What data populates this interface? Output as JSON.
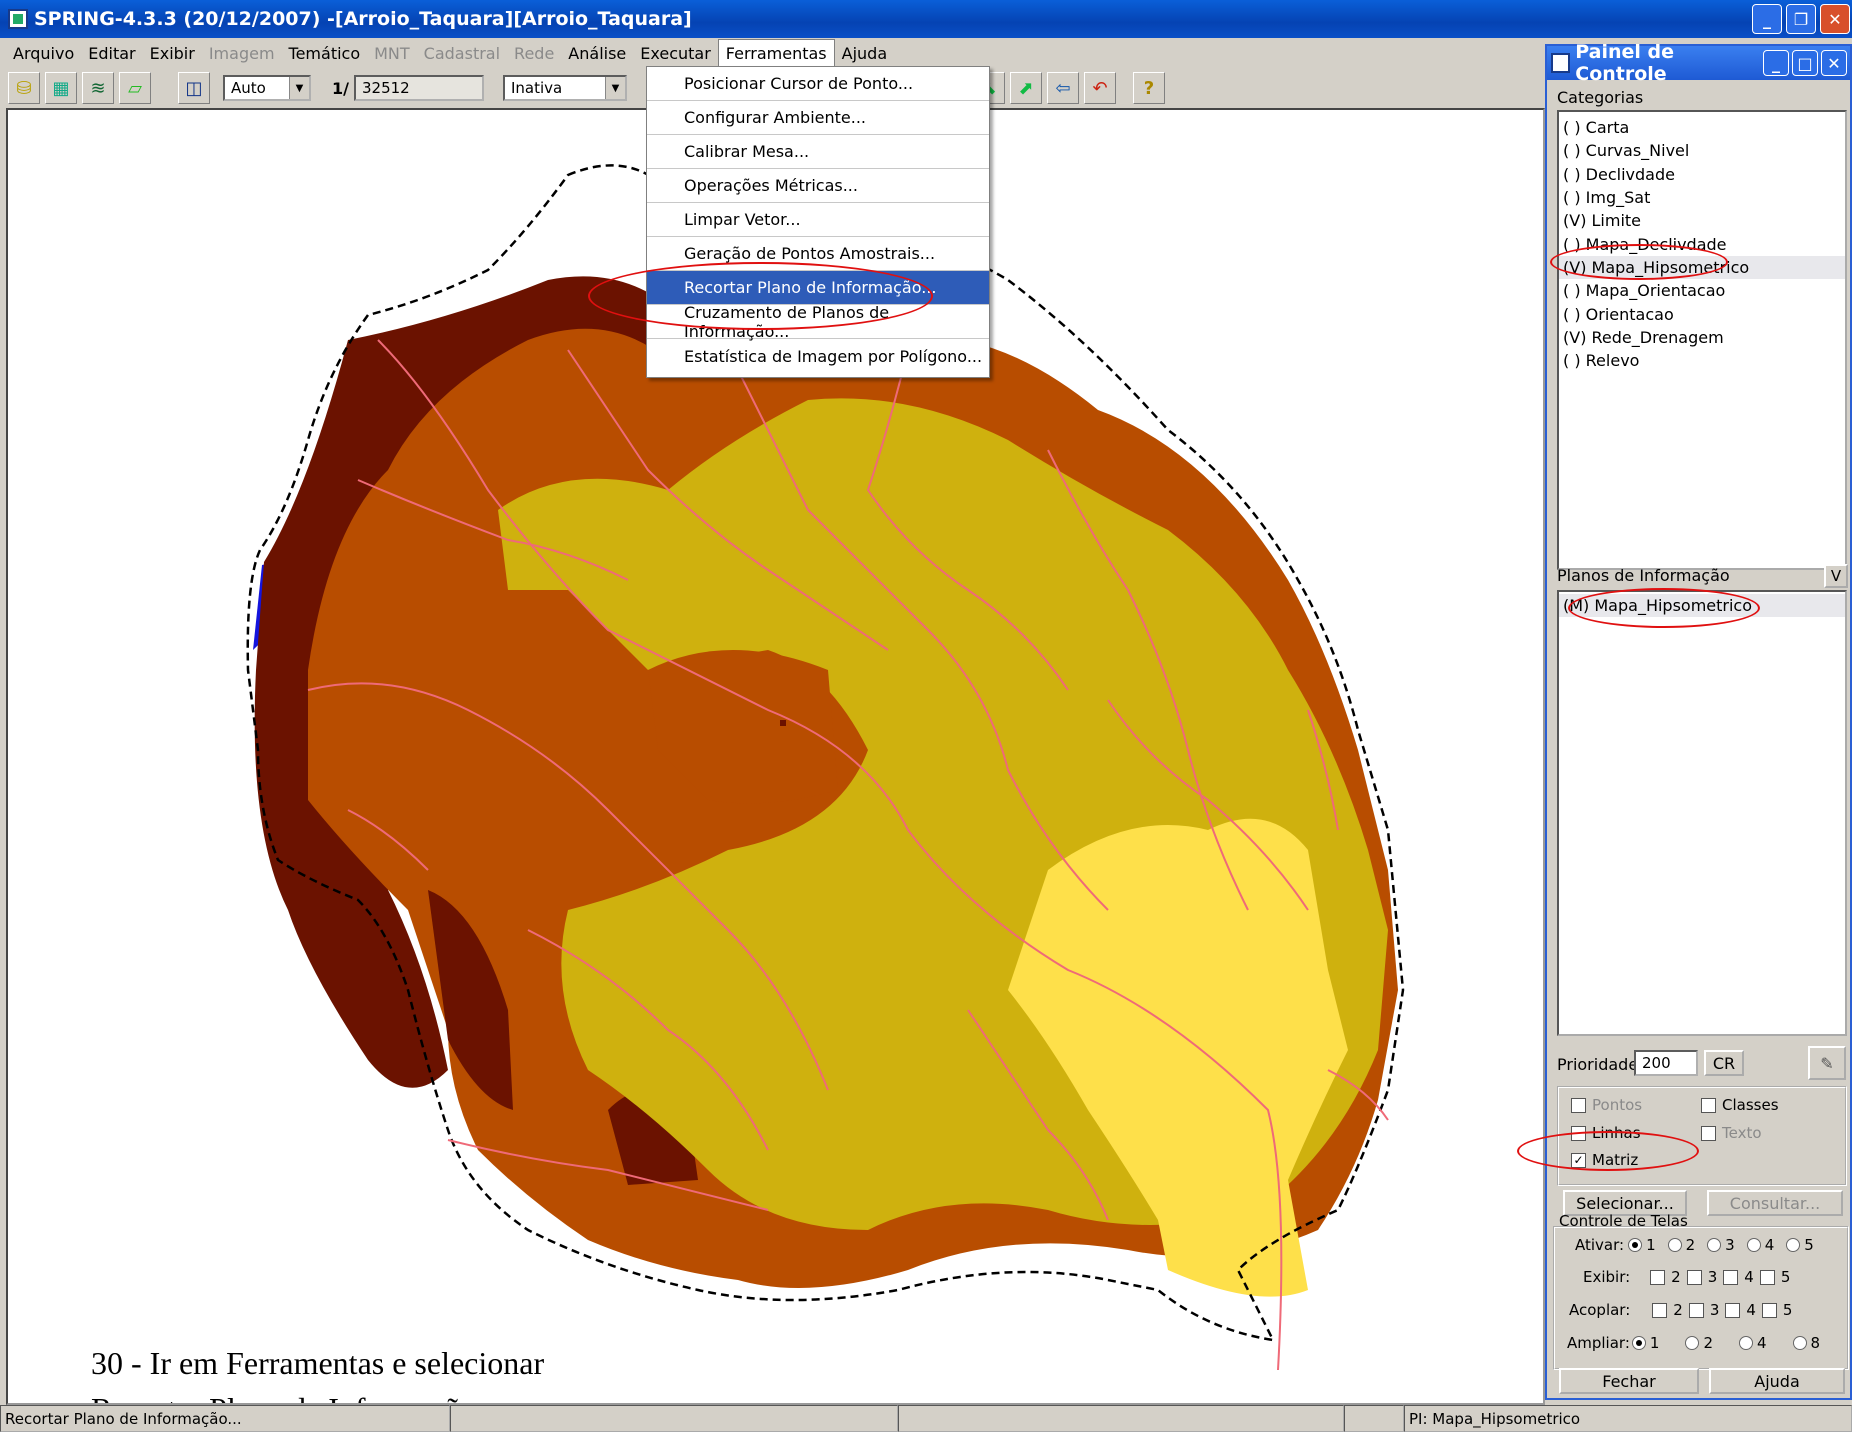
{
  "window": {
    "title": "SPRING-4.3.3 (20/12/2007) -[Arroio_Taquara][Arroio_Taquara]"
  },
  "menubar": [
    {
      "label": "Arquivo",
      "enabled": true
    },
    {
      "label": "Editar",
      "enabled": true
    },
    {
      "label": "Exibir",
      "enabled": true
    },
    {
      "label": "Imagem",
      "enabled": false
    },
    {
      "label": "Temático",
      "enabled": true
    },
    {
      "label": "MNT",
      "enabled": false
    },
    {
      "label": "Cadastral",
      "enabled": false
    },
    {
      "label": "Rede",
      "enabled": false
    },
    {
      "label": "Análise",
      "enabled": true
    },
    {
      "label": "Executar",
      "enabled": true
    },
    {
      "label": "Ferramentas",
      "enabled": true,
      "open": true
    },
    {
      "label": "Ajuda",
      "enabled": true
    }
  ],
  "toolbar": {
    "zoom_mode": "Auto",
    "scale_prefix": "1/",
    "scale_value": "32512",
    "status_combo": "Inativa"
  },
  "ferramentas_menu": [
    {
      "label": "Posicionar Cursor de Ponto..."
    },
    {
      "label": "Configurar Ambiente..."
    },
    {
      "label": "Calibrar Mesa..."
    },
    {
      "label": "Operações Métricas..."
    },
    {
      "label": "Limpar Vetor..."
    },
    {
      "label": "Geração de Pontos Amostrais..."
    },
    {
      "label": "Recortar Plano de Informação...",
      "selected": true
    },
    {
      "label": "Cruzamento de Planos de Informação..."
    },
    {
      "label": "Estatística de Imagem por Polígono..."
    }
  ],
  "panel": {
    "title": "Painel de Controle",
    "categorias_label": "Categorias",
    "categorias": [
      "( ) Carta",
      "( ) Curvas_Nivel",
      "( ) Declivdade",
      "( ) Img_Sat",
      "(V) Limite",
      "( ) Mapa_Declivdade",
      "(V) Mapa_Hipsometrico",
      "( ) Mapa_Orientacao",
      "( ) Orientacao",
      "(V) Rede_Drenagem",
      "( ) Relevo"
    ],
    "planos_label": "Planos de Informação",
    "planos_v": "V",
    "planos": [
      "(M) Mapa_Hipsometrico"
    ],
    "prioridade_label": "Prioridade:",
    "prioridade_value": "200",
    "cr_label": "CR",
    "checks": {
      "pontos": "Pontos",
      "classes": "Classes",
      "linhas": "Linhas",
      "texto": "Texto",
      "matriz": "Matriz",
      "matriz_checked": true
    },
    "selecionar": "Selecionar...",
    "consultar": "Consultar...",
    "controle_label": "Controle de Telas",
    "ativar_label": "Ativar:",
    "exibir_label": "Exibir:",
    "acoplar_label": "Acoplar:",
    "ampliar_label": "Ampliar:",
    "tela_numbers": [
      "1",
      "2",
      "3",
      "4",
      "5"
    ],
    "ampliar_numbers": [
      "1",
      "2",
      "4",
      "8"
    ],
    "fechar": "Fechar",
    "ajuda": "Ajuda"
  },
  "caption": {
    "line1": "30 -  Ir em Ferramentas e selecionar",
    "line2": "Recortar Plano de Informação."
  },
  "statusbar": {
    "left": "Recortar Plano de Informação...",
    "right": "PI: Mapa_Hipsometrico"
  },
  "map_colors": {
    "darkest": "#6b1200",
    "dark": "#b84d00",
    "mid": "#cfb10e",
    "light": "#fee04a",
    "drainage": "#ef6a78",
    "water": "#1414dd"
  }
}
